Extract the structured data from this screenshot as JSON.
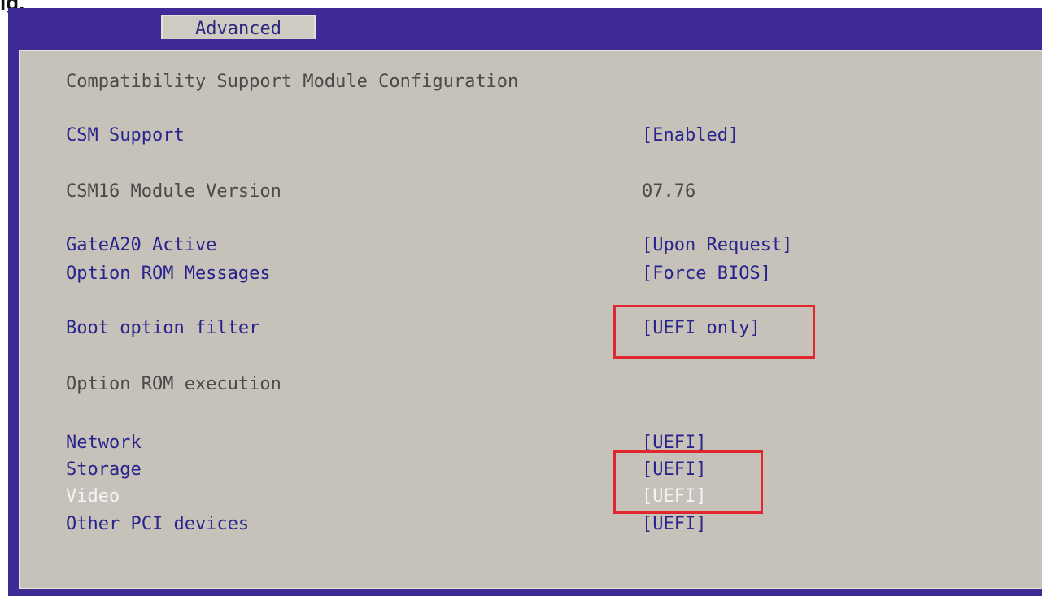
{
  "corner_text": "ig.",
  "tabs": [
    {
      "label": "Advanced"
    }
  ],
  "section_title": "Compatibility Support Module Configuration",
  "settings": [
    {
      "label": "CSM Support",
      "value": "[Enabled]"
    },
    {
      "label": "CSM16 Module Version",
      "value": "07.76"
    },
    {
      "label": "GateA20 Active",
      "value": "[Upon Request]"
    },
    {
      "label": "Option ROM Messages",
      "value": "[Force BIOS]"
    },
    {
      "label": "Boot option filter",
      "value": "[UEFI only]"
    },
    {
      "label": "Option ROM execution"
    },
    {
      "label": "Network",
      "value": "[UEFI]"
    },
    {
      "label": "Storage",
      "value": "[UEFI]"
    },
    {
      "label": "Video",
      "value": "[UEFI]",
      "selected": true
    },
    {
      "label": "Other PCI devices",
      "value": "[UEFI]"
    }
  ],
  "colors": {
    "header_bar": "#3f2a96",
    "panel_background": "#c7c2b9",
    "option_text": "#28238d",
    "static_text": "#4a4a4a",
    "selected_text": "#f4f4f8",
    "highlight_box": "#e0262e"
  }
}
